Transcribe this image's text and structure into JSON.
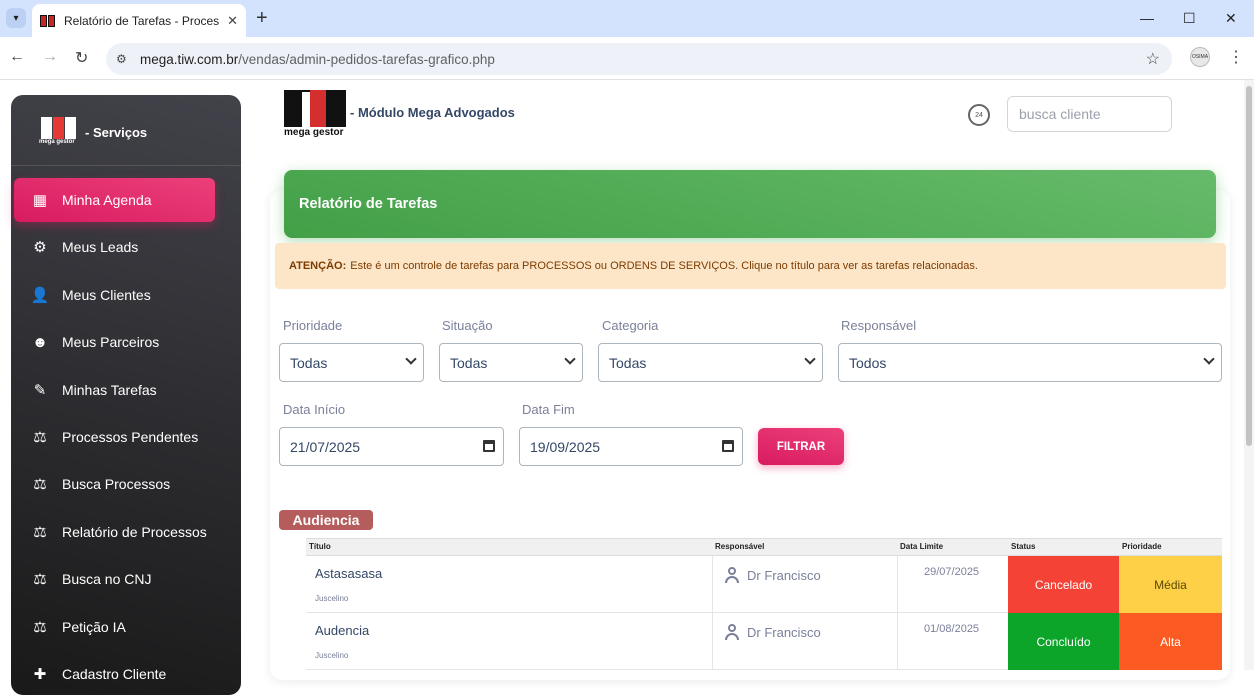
{
  "browser": {
    "tab_title": "Relatório de Tarefas - Processos",
    "url_host": "mega.tiw.com.br",
    "url_path": "/vendas/admin-pedidos-tarefas-grafico.php",
    "profile_label": "OSIMA"
  },
  "sidebar": {
    "brand_logo_text": "mega gestor",
    "brand_label": "- Serviços",
    "items": [
      {
        "label": "Minha Agenda",
        "icon": "calendar-icon",
        "active": true
      },
      {
        "label": "Meus Leads",
        "icon": "user-gear-icon",
        "active": false
      },
      {
        "label": "Meus Clientes",
        "icon": "user-icon",
        "active": false
      },
      {
        "label": "Meus Parceiros",
        "icon": "users-group-icon",
        "active": false
      },
      {
        "label": "Minhas Tarefas",
        "icon": "user-tasks-icon",
        "active": false
      },
      {
        "label": "Processos Pendentes",
        "icon": "gavel-icon",
        "active": false
      },
      {
        "label": "Busca Processos",
        "icon": "gavel-icon",
        "active": false
      },
      {
        "label": "Relatório de Processos",
        "icon": "gavel-icon",
        "active": false
      },
      {
        "label": "Busca no CNJ",
        "icon": "gavel-icon",
        "active": false
      },
      {
        "label": "Petição IA",
        "icon": "gavel-icon",
        "active": false
      },
      {
        "label": "Cadastro Cliente",
        "icon": "user-plus-icon",
        "active": false
      }
    ]
  },
  "header": {
    "logo_text": "mega gestor",
    "module_title": "- Módulo Mega Advogados",
    "history_icon_text": "24",
    "search_placeholder": "busca cliente"
  },
  "report": {
    "title": "Relatório de Tarefas",
    "alert_strong": "ATENÇÃO:",
    "alert_text": "Este é um controle de tarefas para PROCESSOS ou ORDENS DE SERVIÇOS. Clique no título para ver as tarefas relacionadas."
  },
  "filters": {
    "prioridade_label": "Prioridade",
    "prioridade_value": "Todas",
    "situacao_label": "Situação",
    "situacao_value": "Todas",
    "categoria_label": "Categoria",
    "categoria_value": "Todas",
    "responsavel_label": "Responsável",
    "responsavel_value": "Todos",
    "data_inicio_label": "Data Início",
    "data_inicio_value": "21/07/2025",
    "data_fim_label": "Data Fim",
    "data_fim_value": "19/09/2025",
    "filter_button": "FILTRAR"
  },
  "group": {
    "name": "Audiencia",
    "columns": [
      "Título",
      "Responsável",
      "Data Limite",
      "Status",
      "Prioridade"
    ],
    "rows": [
      {
        "title": "Astasasasa",
        "sub": "Juscelino",
        "responsavel": "Dr Francisco",
        "data": "29/07/2025",
        "status": "Cancelado",
        "status_color": "#f44336",
        "prioridade": "Média",
        "prio_color": "#fdd047",
        "prio_text_color": "#5a4a00"
      },
      {
        "title": "Audencia",
        "sub": "Juscelino",
        "responsavel": "Dr Francisco",
        "data": "01/08/2025",
        "status": "Concluído",
        "status_color": "#0ca52a",
        "prioridade": "Alta",
        "prio_color": "#fb5a22",
        "prio_text_color": "#ffffff"
      }
    ]
  },
  "colors": {
    "accent_pink": "#e91e63",
    "header_green": "#4caf50",
    "sidebar_dark": "#1f1f22"
  }
}
